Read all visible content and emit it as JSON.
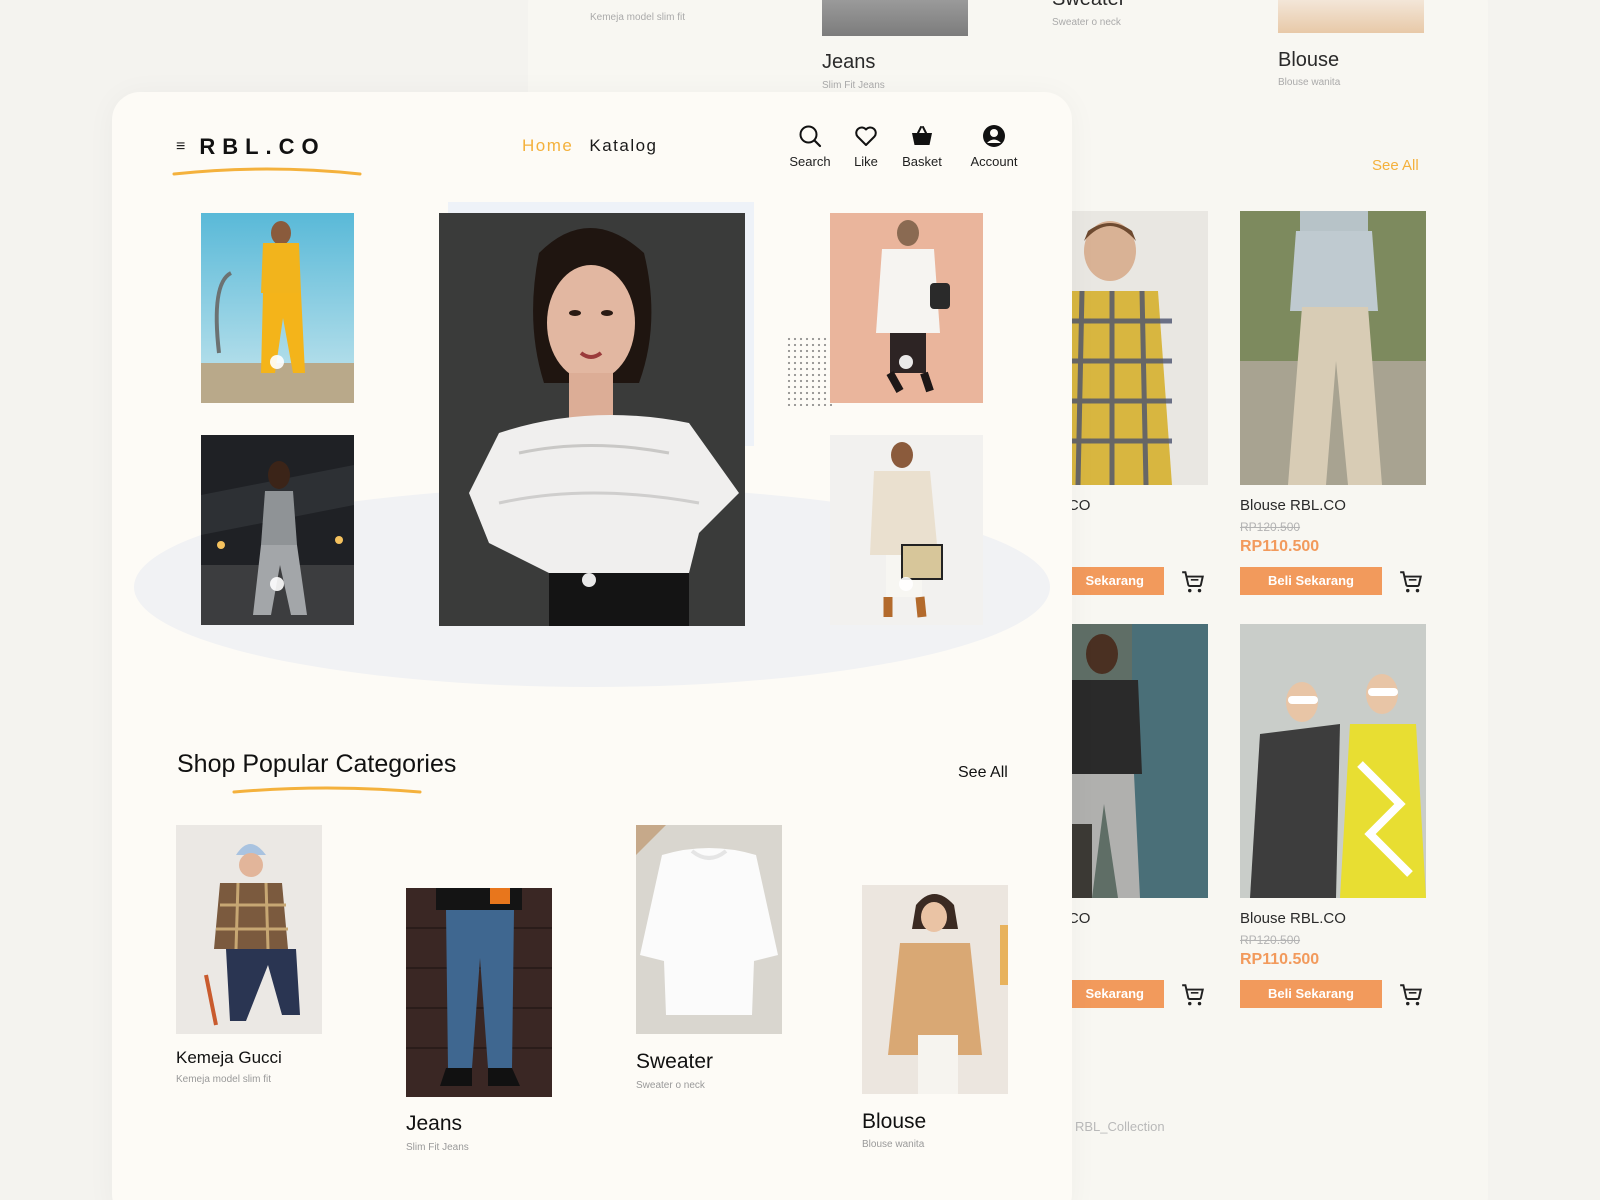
{
  "background": {
    "top_categories": [
      {
        "name": "",
        "sub": "Kemeja model slim fit"
      },
      {
        "name": "Jeans",
        "sub": "Slim Fit Jeans"
      },
      {
        "name": "Sweater",
        "sub": "Sweater o neck"
      },
      {
        "name": "Blouse",
        "sub": "Blouse wanita"
      }
    ],
    "see_all": "See All",
    "products": [
      {
        "title": "a RBL.CO",
        "old_price": "00",
        "new_price": "500",
        "buy_label": "Sekarang"
      },
      {
        "title": "Blouse RBL.CO",
        "old_price": "RP120.500",
        "new_price": "RP110.500",
        "buy_label": "Beli Sekarang"
      },
      {
        "title": "a RBL.CO",
        "old_price": "00",
        "new_price": "500",
        "buy_label": "Sekarang"
      },
      {
        "title": "Blouse RBL.CO",
        "old_price": "RP120.500",
        "new_price": "RP110.500",
        "buy_label": "Beli Sekarang"
      }
    ],
    "footer": "RBL_Collection"
  },
  "header": {
    "logo": "RBL.CO",
    "hamburger": "≡",
    "nav": [
      {
        "label": "Home",
        "active": true
      },
      {
        "label": "Katalog",
        "active": false
      }
    ],
    "actions": [
      {
        "label": "Search",
        "icon": "search-icon"
      },
      {
        "label": "Like",
        "icon": "heart-icon"
      },
      {
        "label": "Basket",
        "icon": "basket-icon"
      },
      {
        "label": "Account",
        "icon": "account-icon"
      }
    ]
  },
  "categories": {
    "title": "Shop Popular Categories",
    "see_all": "See All",
    "items": [
      {
        "name": "Kemeja Gucci",
        "sub": "Kemeja model slim fit"
      },
      {
        "name": "Jeans",
        "sub": "Slim Fit Jeans"
      },
      {
        "name": "Sweater",
        "sub": "Sweater o neck"
      },
      {
        "name": "Blouse",
        "sub": "Blouse wanita"
      }
    ]
  },
  "colors": {
    "accent_yellow": "#f4b13c",
    "accent_orange": "#f29a5c",
    "card_bg": "#fdfbf6"
  }
}
